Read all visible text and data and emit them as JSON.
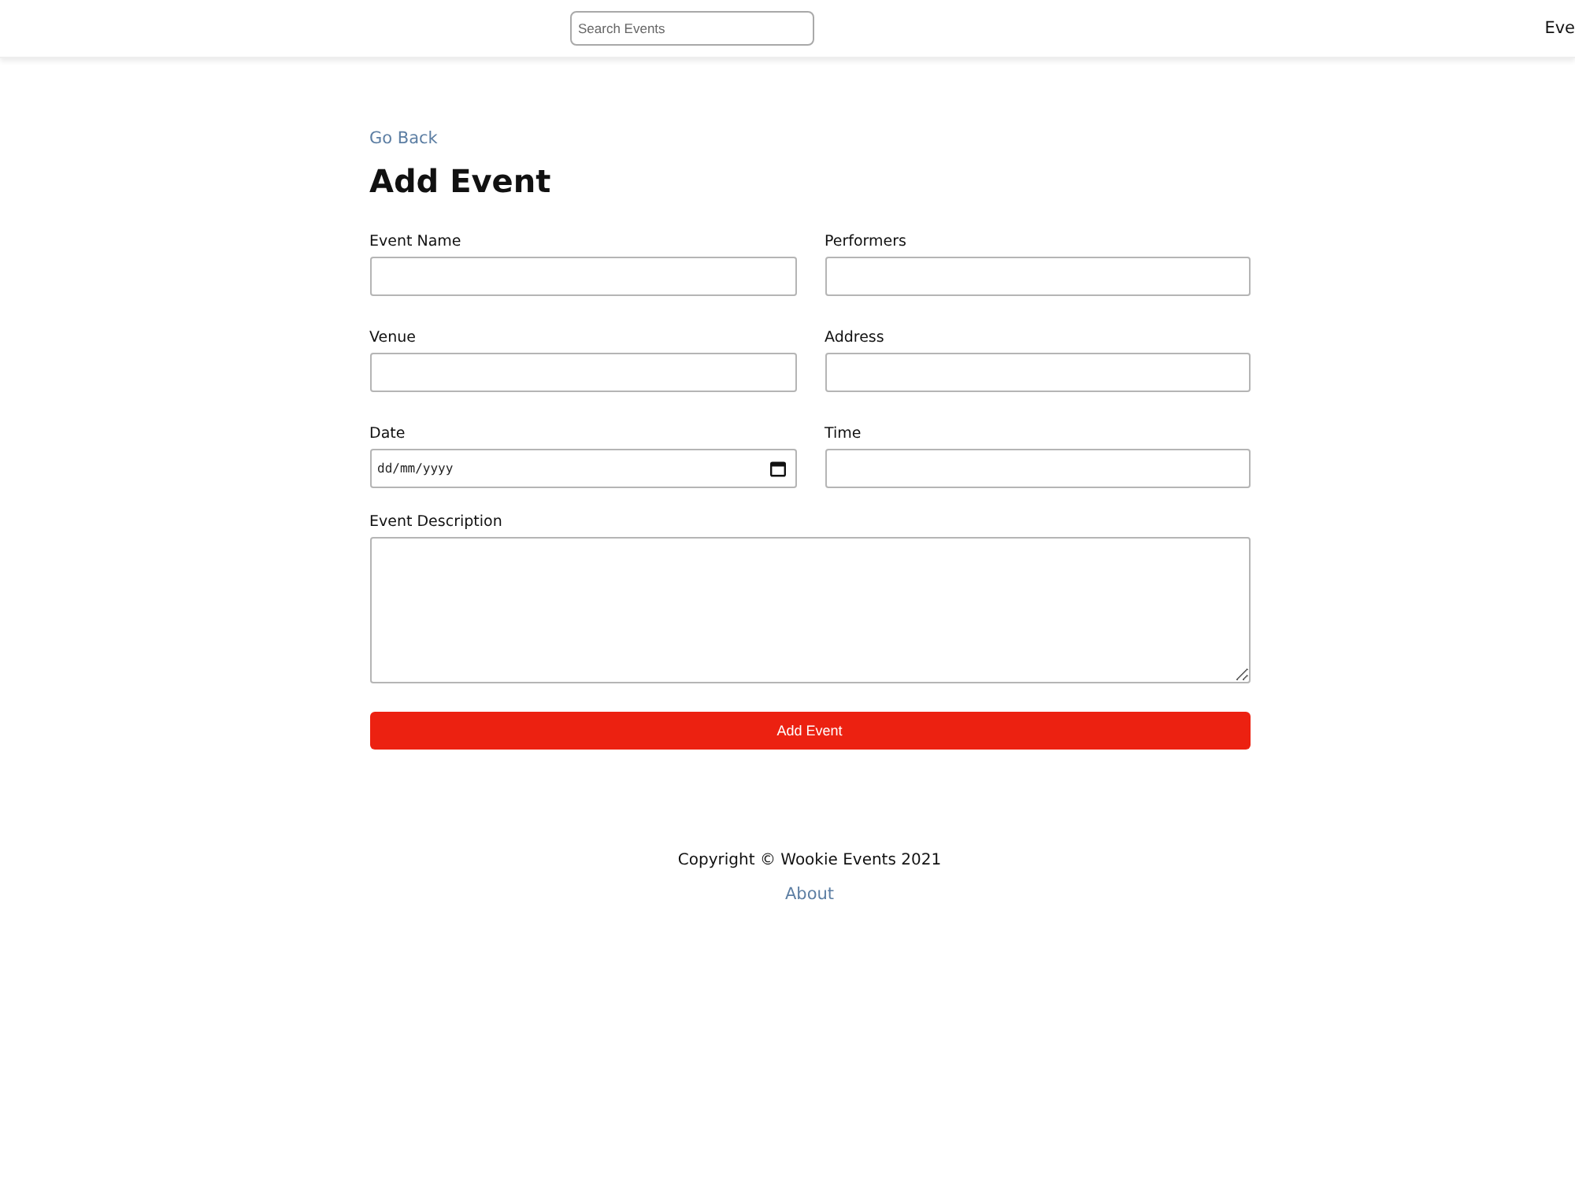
{
  "header": {
    "search": {
      "placeholder": "Search Events"
    },
    "nav_link": "Eve"
  },
  "back_link": "Go Back",
  "title": "Add Event",
  "fields": [
    {
      "kind": "text",
      "label": "Event Name"
    },
    {
      "kind": "text",
      "label": "Performers"
    },
    {
      "kind": "text",
      "label": "Venue"
    },
    {
      "kind": "text",
      "label": "Address"
    },
    {
      "kind": "date",
      "label": "Date",
      "placeholder": "dd/mm/yyyy"
    },
    {
      "kind": "text",
      "label": "Time"
    },
    {
      "kind": "textarea",
      "label": "Event Description"
    }
  ],
  "submit_button": "Add Event",
  "footer": {
    "copyright": "Copyright © Wookie Events 2021",
    "link": "About"
  }
}
